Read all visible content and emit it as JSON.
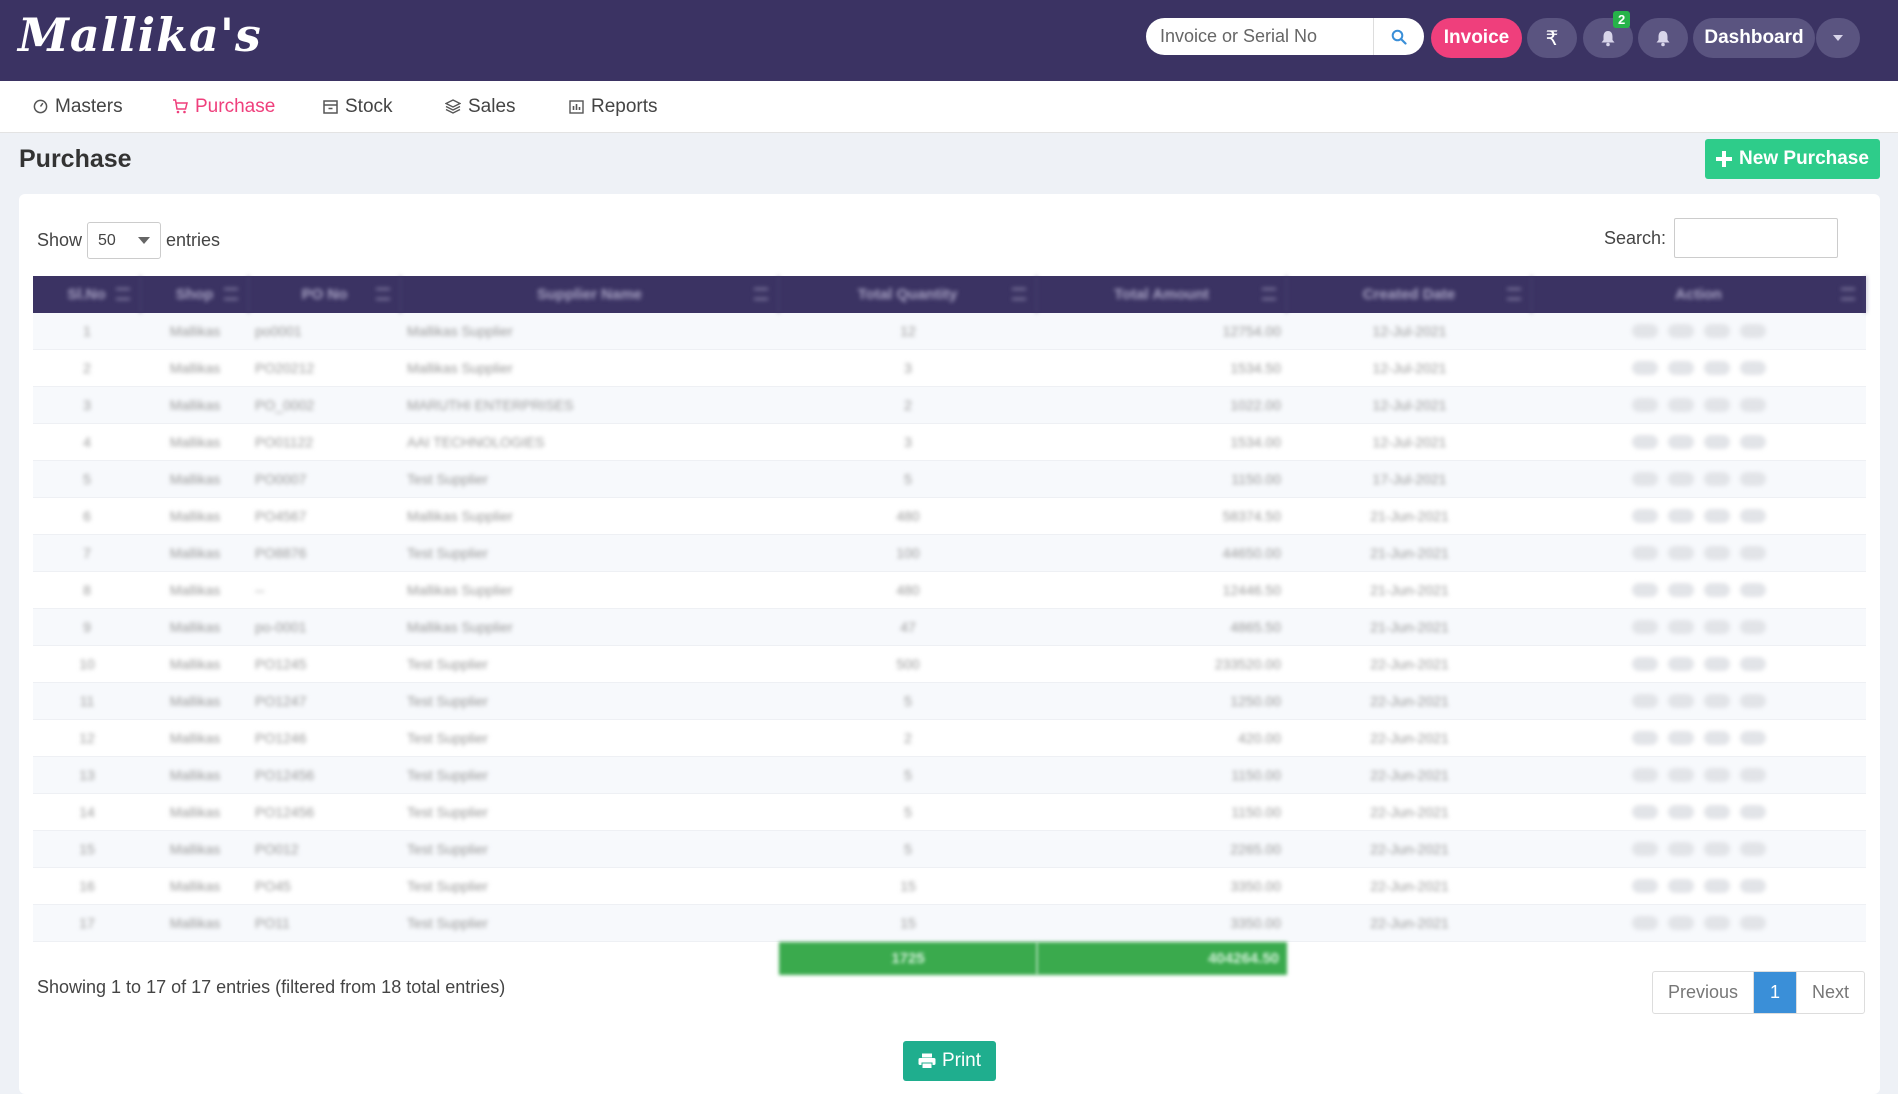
{
  "brand": {
    "logo_text": "Mallika's"
  },
  "header": {
    "search_placeholder": "Invoice or Serial No",
    "invoice_label": "Invoice",
    "rupee_symbol": "₹",
    "notification_count": "2",
    "dashboard_label": "Dashboard",
    "colors": {
      "bar": "#3b3363",
      "invoice": "#ef3f7c",
      "badge": "#27b34a"
    }
  },
  "nav": {
    "items": [
      {
        "label": "Masters",
        "icon": "dashboard-icon"
      },
      {
        "label": "Purchase",
        "icon": "cart-icon",
        "active": true
      },
      {
        "label": "Stock",
        "icon": "box-icon"
      },
      {
        "label": "Sales",
        "icon": "layers-icon"
      },
      {
        "label": "Reports",
        "icon": "chart-icon"
      }
    ]
  },
  "page": {
    "title": "Purchase",
    "new_button": "New Purchase"
  },
  "table_controls": {
    "show_label": "Show",
    "page_length": "50",
    "entries_label": "entries",
    "search_label": "Search:"
  },
  "table": {
    "columns": [
      "Sl.No",
      "Shop",
      "PO No",
      "Supplier Name",
      "Total Quantity",
      "Total Amount",
      "Created Date",
      "Action"
    ],
    "rows": [
      [
        "1",
        "Mallikas",
        "po0001",
        "Mallikas Supplier",
        "12",
        "12754.00",
        "12-Jul-2021"
      ],
      [
        "2",
        "Mallikas",
        "PO20212",
        "Mallikas Supplier",
        "3",
        "1534.50",
        "12-Jul-2021"
      ],
      [
        "3",
        "Mallikas",
        "PO_0002",
        "MARUTHI ENTERPRISES",
        "2",
        "1022.00",
        "12-Jul-2021"
      ],
      [
        "4",
        "Mallikas",
        "PO01122",
        "AAI TECHNOLOGIES",
        "3",
        "1534.00",
        "12-Jul-2021"
      ],
      [
        "5",
        "Mallikas",
        "PO0007",
        "Test Supplier",
        "5",
        "1150.00",
        "17-Jul-2021"
      ],
      [
        "6",
        "Mallikas",
        "PO4567",
        "Mallikas Supplier",
        "480",
        "58374.50",
        "21-Jun-2021"
      ],
      [
        "7",
        "Mallikas",
        "PO8876",
        "Test Supplier",
        "100",
        "44650.00",
        "21-Jun-2021"
      ],
      [
        "8",
        "Mallikas",
        "--",
        "Mallikas Supplier",
        "480",
        "12446.50",
        "21-Jun-2021"
      ],
      [
        "9",
        "Mallikas",
        "po-0001",
        "Mallikas Supplier",
        "47",
        "4865.50",
        "21-Jun-2021"
      ],
      [
        "10",
        "Mallikas",
        "PO1245",
        "Test Supplier",
        "500",
        "233520.00",
        "22-Jun-2021"
      ],
      [
        "11",
        "Mallikas",
        "PO1247",
        "Test Supplier",
        "5",
        "1250.00",
        "22-Jun-2021"
      ],
      [
        "12",
        "Mallikas",
        "PO1246",
        "Test Supplier",
        "2",
        "420.00",
        "22-Jun-2021"
      ],
      [
        "13",
        "Mallikas",
        "PO12456",
        "Test Supplier",
        "5",
        "1150.00",
        "22-Jun-2021"
      ],
      [
        "14",
        "Mallikas",
        "PO12456",
        "Test Supplier",
        "5",
        "1150.00",
        "22-Jun-2021"
      ],
      [
        "15",
        "Mallikas",
        "PO012",
        "Test Supplier",
        "5",
        "2265.00",
        "22-Jun-2021"
      ],
      [
        "16",
        "Mallikas",
        "PO45",
        "Test Supplier",
        "15",
        "3350.00",
        "22-Jun-2021"
      ],
      [
        "17",
        "Mallikas",
        "PO11",
        "Test Supplier",
        "15",
        "3350.00",
        "22-Jun-2021"
      ]
    ],
    "totals": {
      "quantity": "1725",
      "amount": "404264.50"
    }
  },
  "footer": {
    "info": "Showing 1 to 17 of 17 entries (filtered from 18 total entries)",
    "prev": "Previous",
    "page": "1",
    "next": "Next",
    "print": "Print"
  }
}
